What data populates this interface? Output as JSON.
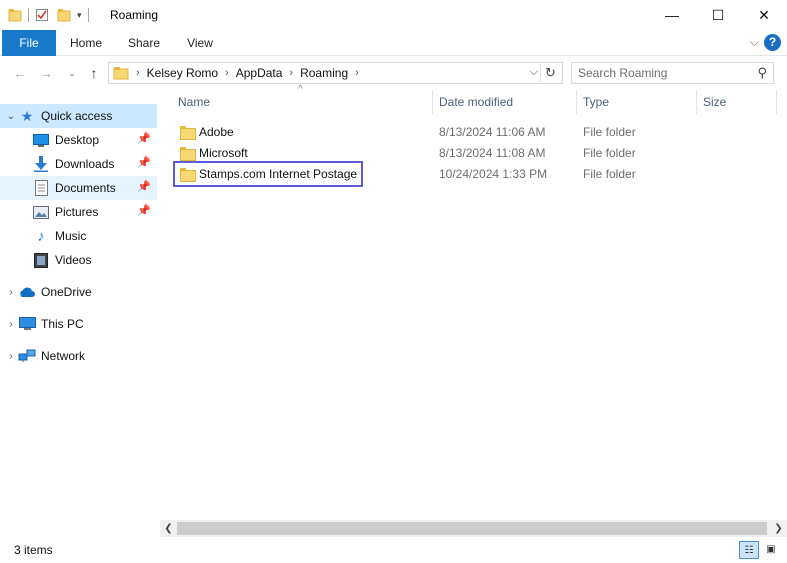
{
  "window": {
    "title": "Roaming",
    "controls": {
      "minimize": "—",
      "maximize": "☐",
      "close": "✕"
    }
  },
  "ribbon": {
    "tabs": [
      "File",
      "Home",
      "Share",
      "View"
    ],
    "help": "?"
  },
  "address_bar": {
    "crumbs": [
      "Kelsey Romo",
      "AppData",
      "Roaming"
    ]
  },
  "search": {
    "placeholder": "Search Roaming"
  },
  "sidebar": {
    "quick_access": "Quick access",
    "items": [
      {
        "label": "Desktop",
        "icon": "desktop-icon",
        "pinned": true
      },
      {
        "label": "Downloads",
        "icon": "downloads-icon",
        "pinned": true
      },
      {
        "label": "Documents",
        "icon": "documents-icon",
        "pinned": true
      },
      {
        "label": "Pictures",
        "icon": "pictures-icon",
        "pinned": true
      },
      {
        "label": "Music",
        "icon": "music-icon",
        "pinned": false
      },
      {
        "label": "Videos",
        "icon": "videos-icon",
        "pinned": false
      }
    ],
    "onedrive": "OneDrive",
    "this_pc": "This PC",
    "network": "Network"
  },
  "columns": {
    "name": "Name",
    "date": "Date modified",
    "type": "Type",
    "size": "Size"
  },
  "files": [
    {
      "name": "Adobe",
      "date": "8/13/2024 11:06 AM",
      "type": "File folder"
    },
    {
      "name": "Microsoft",
      "date": "8/13/2024 11:08 AM",
      "type": "File folder"
    },
    {
      "name": "Stamps.com Internet Postage",
      "date": "10/24/2024 1:33 PM",
      "type": "File folder"
    }
  ],
  "status": {
    "item_count": "3 items"
  },
  "colors": {
    "accent": "#1979ca",
    "selected": "#cce8ff",
    "focus_outline": "#5b5bd6"
  }
}
